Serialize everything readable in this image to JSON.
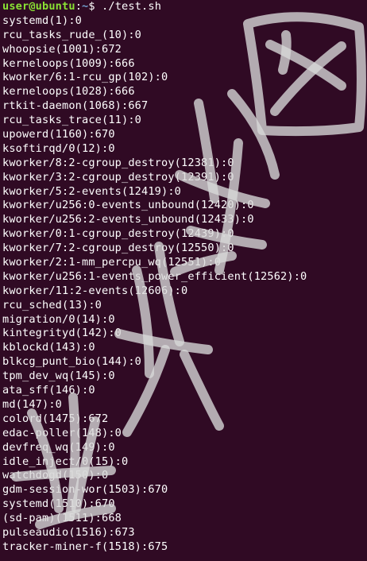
{
  "prompt": {
    "user_host": "user@ubuntu",
    "separator": ":",
    "path": "~",
    "symbol": "$",
    "command": " ./test.sh"
  },
  "output_lines": [
    "systemd(1):0",
    "rcu_tasks_rude_(10):0",
    "whoopsie(1001):672",
    "kerneloops(1009):666",
    "kworker/6:1-rcu_gp(102):0",
    "kerneloops(1028):666",
    "rtkit-daemon(1068):667",
    "rcu_tasks_trace(11):0",
    "upowerd(1160):670",
    "ksoftirqd/0(12):0",
    "kworker/8:2-cgroup_destroy(12381):0",
    "kworker/3:2-cgroup_destroy(12391):0",
    "kworker/5:2-events(12419):0",
    "kworker/u256:0-events_unbound(12420):0",
    "kworker/u256:2-events_unbound(12433):0",
    "kworker/0:1-cgroup_destroy(12439):0",
    "kworker/7:2-cgroup_destroy(12550):0",
    "kworker/2:1-mm_percpu_wq(12551):0",
    "kworker/u256:1-events_power_efficient(12562):0",
    "kworker/11:2-events(12606):0",
    "rcu_sched(13):0",
    "migration/0(14):0",
    "kintegrityd(142):0",
    "kblockd(143):0",
    "blkcg_punt_bio(144):0",
    "tpm_dev_wq(145):0",
    "ata_sff(146):0",
    "md(147):0",
    "colord(1475):672",
    "edac-poller(148):0",
    "devfreq_wq(149):0",
    "idle_inject/0(15):0",
    "watchdogd(150):0",
    "gdm-session-wor(1503):670",
    "systemd(1510):670",
    "(sd-pam)(1511):668",
    "pulseaudio(1516):673",
    "tracker-miner-f(1518):675"
  ],
  "colors": {
    "background": "#300a24",
    "text": "#ffffff",
    "prompt_user": "#8ae234",
    "prompt_path": "#729fcf",
    "watermark": "#d8d8d8"
  }
}
